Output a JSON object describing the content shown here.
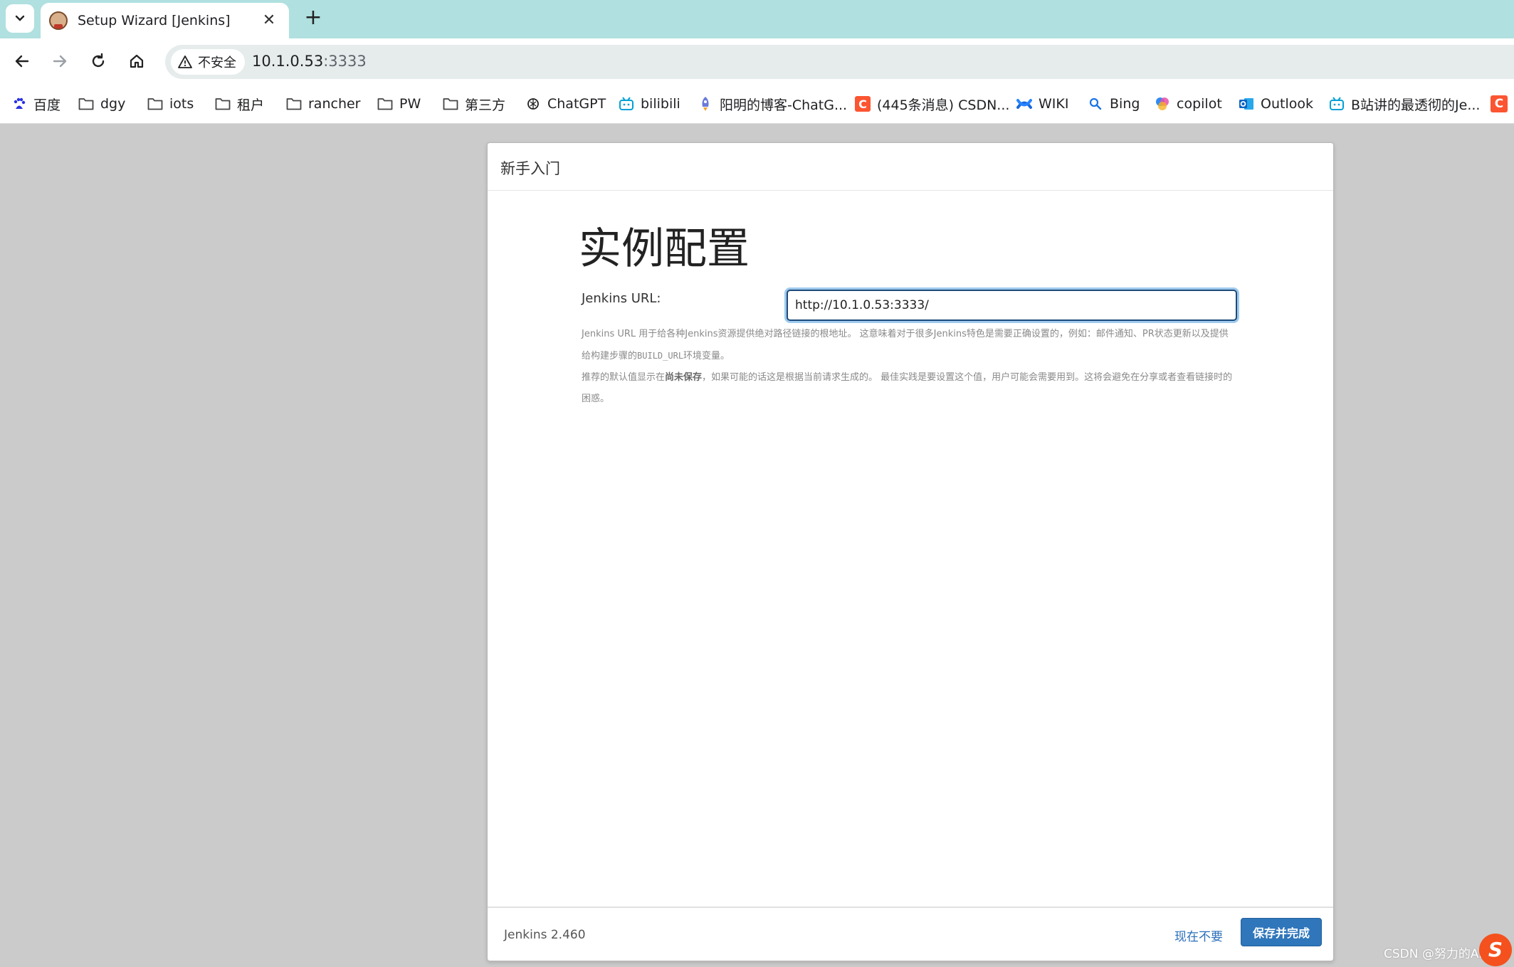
{
  "browser": {
    "tab": {
      "title": "Setup Wizard [Jenkins]"
    },
    "address": {
      "security_label": "不安全",
      "host": "10.1.0.53",
      "port": ":3333"
    },
    "bookmarks": [
      {
        "label": "百度",
        "icon": "baidu-icon"
      },
      {
        "label": "dgy",
        "icon": "folder-icon"
      },
      {
        "label": "iots",
        "icon": "folder-icon"
      },
      {
        "label": "租户",
        "icon": "folder-icon"
      },
      {
        "label": "rancher",
        "icon": "folder-icon"
      },
      {
        "label": "PW",
        "icon": "folder-icon"
      },
      {
        "label": "第三方",
        "icon": "folder-icon"
      },
      {
        "label": "ChatGPT",
        "icon": "chatgpt-icon"
      },
      {
        "label": "bilibili",
        "icon": "bilibili-icon"
      },
      {
        "label": "阳明的博客-ChatG...",
        "icon": "rocket-icon"
      },
      {
        "label": "(445条消息) CSDN...",
        "icon": "csdn-icon"
      },
      {
        "label": "WIKI",
        "icon": "wiki-icon"
      },
      {
        "label": "Bing",
        "icon": "bing-search-icon"
      },
      {
        "label": "copilot",
        "icon": "copilot-icon"
      },
      {
        "label": "Outlook",
        "icon": "outlook-icon"
      },
      {
        "label": "B站讲的最透彻的Je...",
        "icon": "bilibili-icon"
      },
      {
        "label": "C",
        "icon": "csdn-icon"
      }
    ]
  },
  "dialog": {
    "header_title": "新手入门",
    "heading": "实例配置",
    "field_label": "Jenkins URL:",
    "url_value": "http://10.1.0.53:3333/",
    "help_1a": "Jenkins URL 用于给各种Jenkins资源提供绝对路径链接的根地址。 这意味着对于很多Jenkins特色是需要正确设置的，例如：邮件通知、PR状态更新以及提供给构建步骤的",
    "help_1_code": "BUILD_URL",
    "help_1b": "环境变量。",
    "help_2a": "推荐的默认值显示在",
    "help_2_bold": "尚未保存",
    "help_2b": "，如果可能的话这是根据当前请求生成的。 最佳实践是要设置这个值，用户可能会需要用到。这将会避免在分享或者查看链接时的困惑。",
    "version": "Jenkins 2.460",
    "skip_label": "现在不要",
    "save_label": "保存并完成"
  },
  "overlay": {
    "watermark": "CSDN @努力的Andy"
  },
  "colors": {
    "tabstrip": "#b0e0e0",
    "primary_button": "#2f76bb",
    "link": "#2a6ebb",
    "backdrop": "#cbcbcb"
  }
}
